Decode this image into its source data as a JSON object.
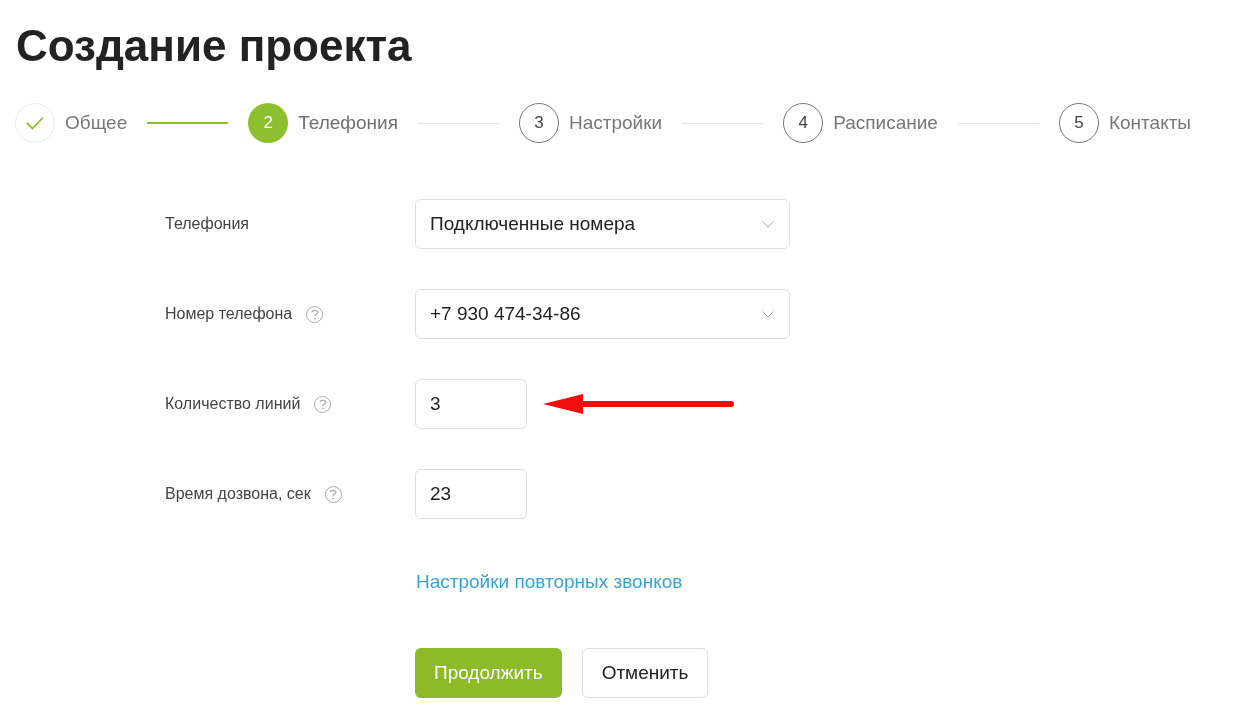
{
  "title": "Создание проекта",
  "steps": [
    {
      "label": "Общее",
      "done": true,
      "selected": false
    },
    {
      "number": "2",
      "label": "Телефония",
      "done": false,
      "selected": true
    },
    {
      "number": "3",
      "label": "Настройки",
      "done": false,
      "selected": false
    },
    {
      "number": "4",
      "label": "Расписание",
      "done": false,
      "selected": false
    },
    {
      "number": "5",
      "label": "Контакты",
      "done": false,
      "selected": false
    }
  ],
  "fields": [
    {
      "label": "Телефония",
      "kind": "select",
      "value": "Подключенные номера",
      "help": false,
      "arrow": false
    },
    {
      "label": "Номер телефона",
      "kind": "select",
      "value": "+7 930 474-34-86",
      "help": true,
      "arrow": false
    },
    {
      "label": "Количество линий",
      "kind": "input",
      "value": "3",
      "help": true,
      "arrow": true
    },
    {
      "label": "Время дозвона, сек",
      "kind": "input",
      "value": "23",
      "help": true,
      "arrow": false
    }
  ],
  "link": "Настройки повторных звонков",
  "buttons": [
    {
      "label": "Продолжить",
      "kind": "primary"
    },
    {
      "label": "Отменить",
      "kind": "secondary"
    }
  ]
}
